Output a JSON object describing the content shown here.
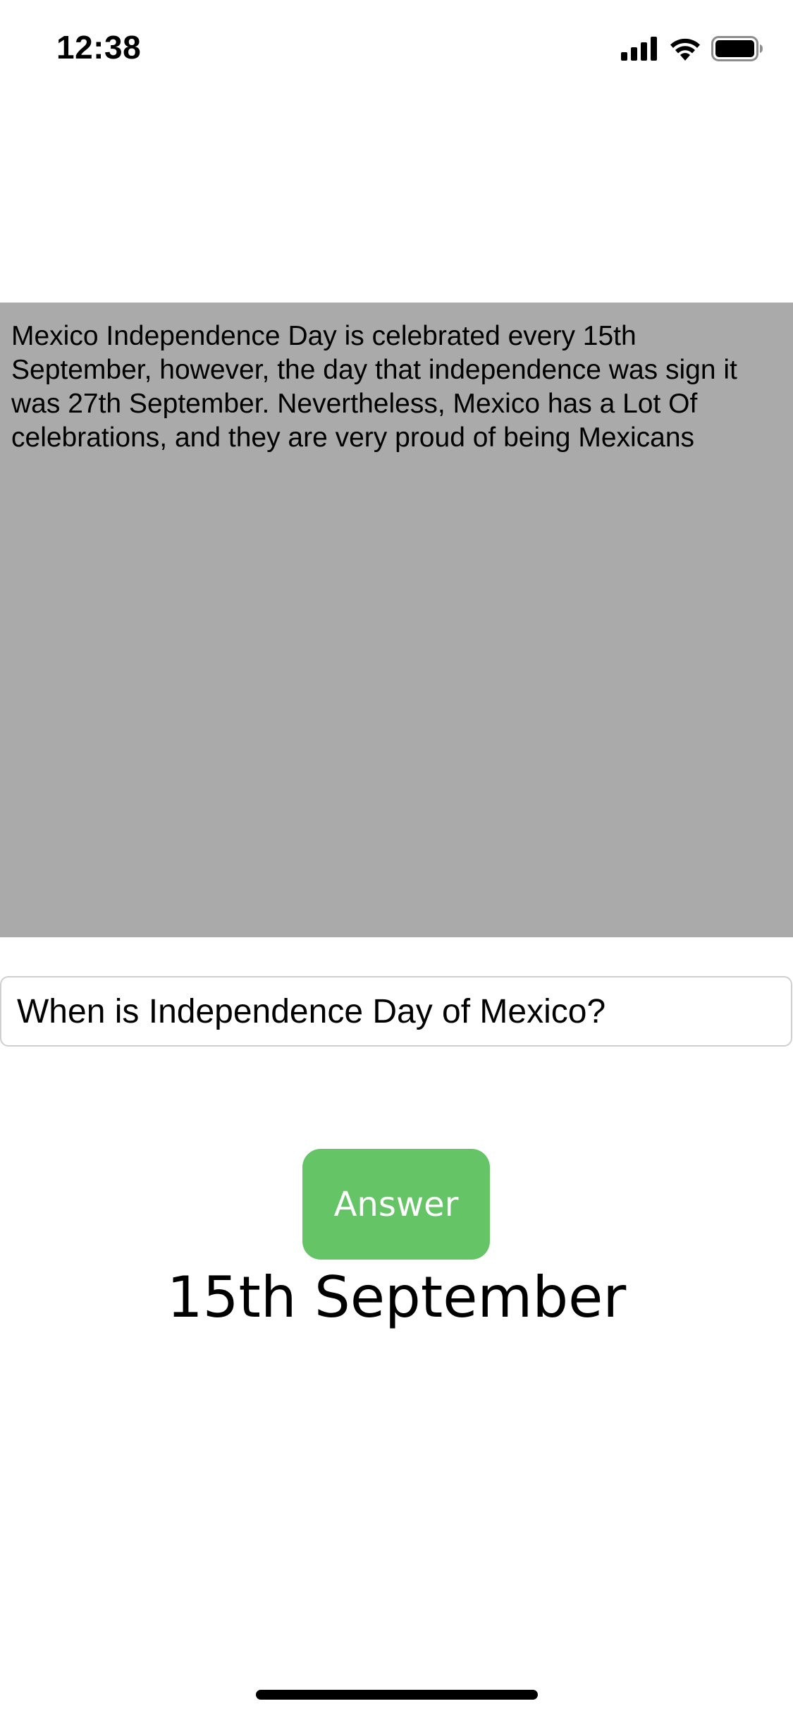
{
  "status_bar": {
    "time": "12:38",
    "icons": [
      "cellular-signal-icon",
      "wifi-icon",
      "battery-icon"
    ]
  },
  "context": {
    "text": "Mexico Independence Day is celebrated every 15th September, however, the day that independence was sign it was 27th September. Nevertheless, Mexico has a Lot Of celebrations, and they are very proud of being Mexicans",
    "background_color": "#aaaaaa"
  },
  "question": {
    "value": "When is Independence Day of Mexico?"
  },
  "answer_button": {
    "label": "Answer",
    "color": "#65c466"
  },
  "answer_result": {
    "text": "15th September"
  }
}
